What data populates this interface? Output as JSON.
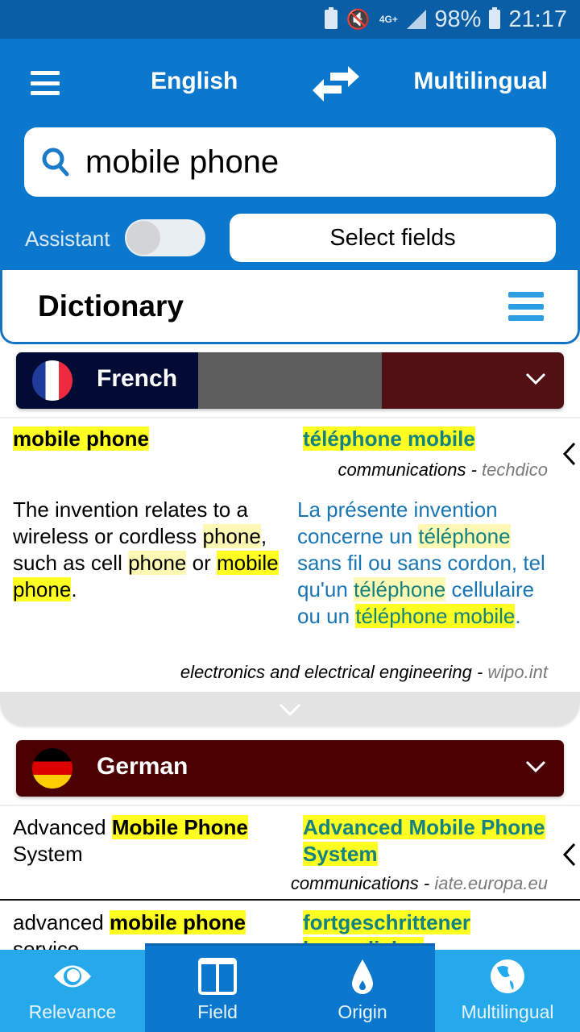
{
  "status_bar": {
    "battery_percent": "98%",
    "time": "21:17",
    "network": "4G+",
    "icons": [
      "battery-saver-icon",
      "mute-vibrate-icon",
      "network-4g-icon",
      "signal-icon",
      "battery-icon"
    ]
  },
  "header": {
    "source_language": "English",
    "target_language": "Multilingual",
    "swap_icon": "swap-arrows-icon",
    "menu_icon": "hamburger-menu-icon"
  },
  "search": {
    "value": "mobile phone",
    "icon": "search-icon"
  },
  "controls": {
    "assistant_label": "Assistant",
    "assistant_on": false,
    "select_fields_label": "Select fields"
  },
  "dictionary": {
    "title": "Dictionary",
    "menu_icon": "list-menu-icon"
  },
  "sections": [
    {
      "language": "French",
      "flag": "france-flag-icon",
      "entries": [
        {
          "source": "mobile phone",
          "target": "téléphone mobile",
          "field": "communications",
          "separator": " - ",
          "origin": "techdico"
        },
        {
          "source_parts": [
            "The invention relates to a wireless or cordless ",
            "phone",
            ", such as cell ",
            "phone",
            " or ",
            "mobile phone",
            "."
          ],
          "target_parts": [
            "La présente invention concerne un ",
            "téléphone",
            " sans fil ou sans cordon, tel qu'un ",
            "téléphone",
            " cellulaire ou un ",
            "téléphone mobile",
            "."
          ],
          "field": "electronics and electrical engineering",
          "separator": " - ",
          "origin": "wipo.int"
        }
      ]
    },
    {
      "language": "German",
      "flag": "germany-flag-icon",
      "entries": [
        {
          "source_parts": [
            "Advanced ",
            "Mobile Phone",
            " System"
          ],
          "target": "Advanced Mobile Phone System",
          "field": "communications",
          "separator": " - ",
          "origin": "iate.europa.eu"
        },
        {
          "source_parts": [
            "advanced ",
            "mobile phone",
            " service"
          ],
          "target": "fortgeschrittener beweglicher"
        }
      ]
    }
  ],
  "bottom_nav": [
    {
      "label": "Relevance",
      "icon": "eye-icon",
      "active": false
    },
    {
      "label": "Field",
      "icon": "columns-icon",
      "active": true
    },
    {
      "label": "Origin",
      "icon": "drop-icon",
      "active": true
    },
    {
      "label": "Multilingual",
      "icon": "globe-icon",
      "active": false
    }
  ],
  "colors": {
    "header_blue": "#0b78cd",
    "status_blue": "#0a5ea6",
    "nav_light_blue": "#26a9ea",
    "highlight_yellow": "#ffff22",
    "target_text_blue": "#1976b4",
    "target_term_teal": "#138280",
    "french_bar": "#020b33",
    "german_bar": "#4b0001"
  }
}
